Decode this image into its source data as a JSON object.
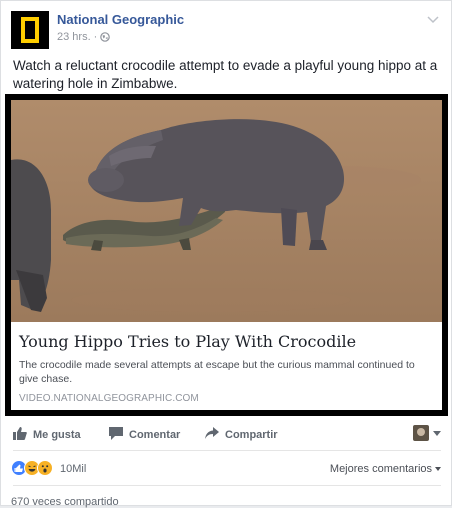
{
  "post": {
    "page_name": "National Geographic",
    "time": "23 hrs.",
    "separator": "·",
    "caption": "Watch a reluctant crocodile attempt to evade a playful young hippo at a watering hole in Zimbabwe.",
    "privacy_icon": "globe-icon",
    "options_icon": "chevron-down-icon"
  },
  "link_card": {
    "title": "Young Hippo Tries to Play With Crocodile",
    "description": "The crocodile made several attempts at escape but the curious mammal continued to give chase.",
    "domain": "VIDEO.NATIONALGEOGRAPHIC.COM"
  },
  "actions": {
    "like": "Me gusta",
    "comment": "Comentar",
    "share": "Compartir"
  },
  "reactions": {
    "icons": [
      "like-icon",
      "haha-icon",
      "wow-icon"
    ],
    "count": "10Mil",
    "sort_label": "Mejores comentarios"
  },
  "shares": {
    "label": "670 veces compartido"
  },
  "colors": {
    "link": "#365899",
    "logo_yellow": "#ffce00",
    "like_blue": "#4080ff",
    "reaction_yellow": "#f7b125"
  }
}
